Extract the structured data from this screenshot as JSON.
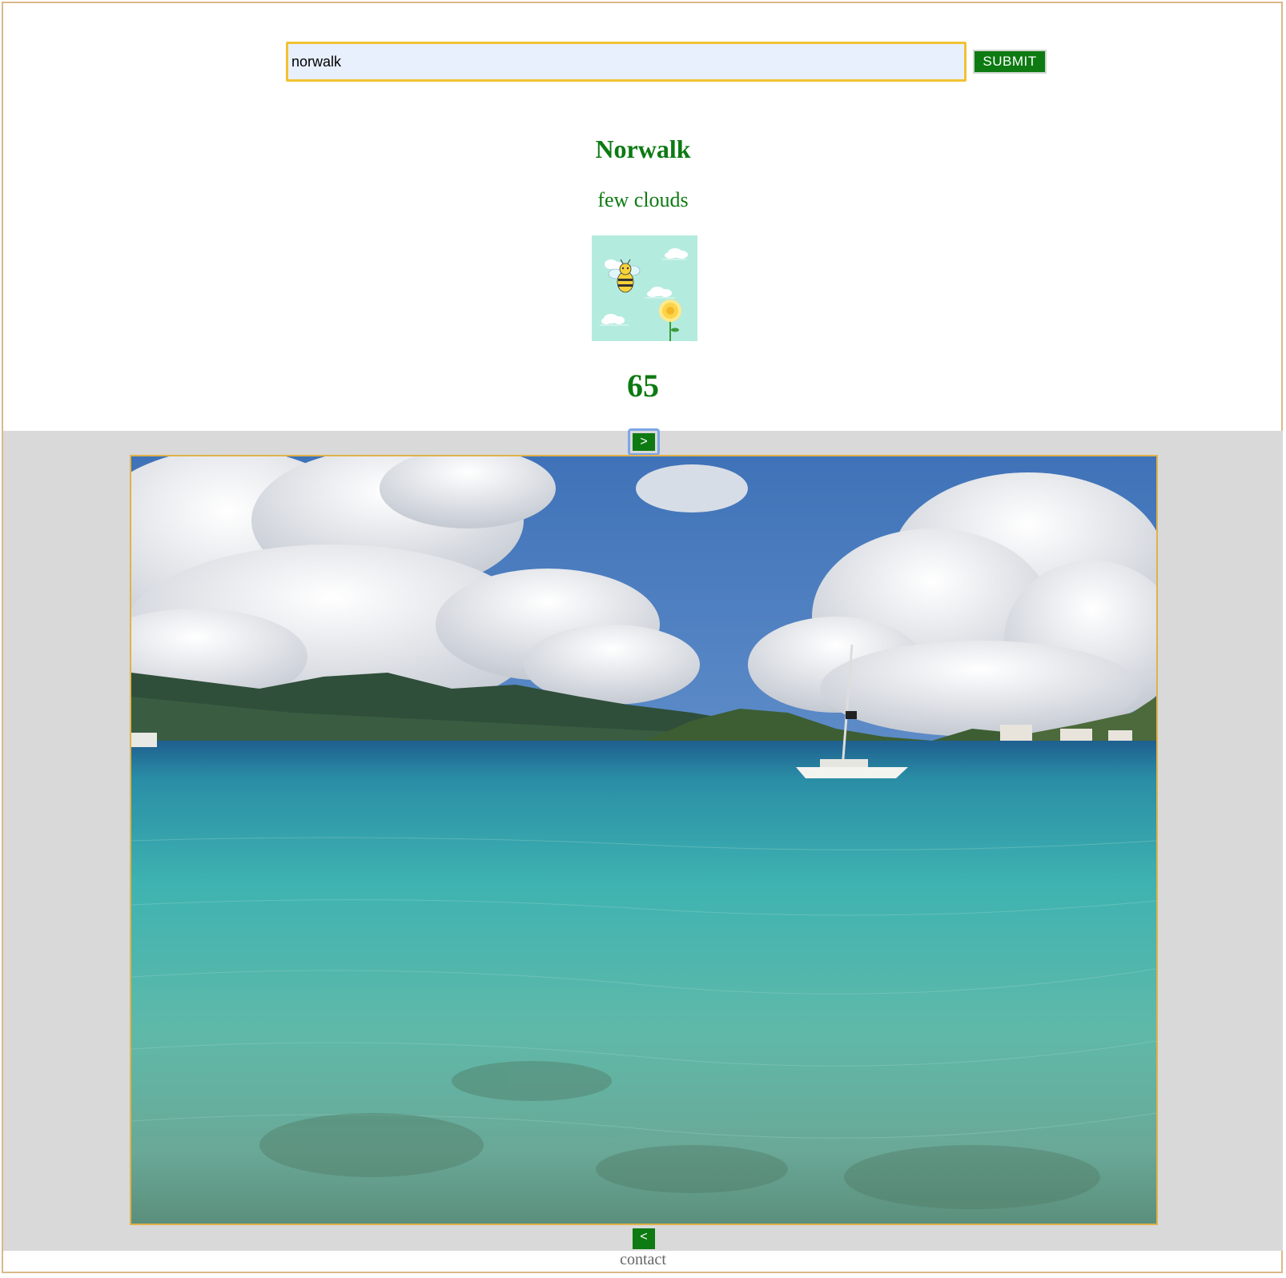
{
  "search": {
    "value": "norwalk",
    "submit_label": "SUBMIT"
  },
  "weather": {
    "city": "Norwalk",
    "description": "few clouds",
    "temperature": "65",
    "icon": "bee-flower-clouds-icon"
  },
  "gallery": {
    "next_label": ">",
    "prev_label": "<",
    "photo": "tropical-bay-sailboat-photo"
  },
  "footer": {
    "contact_label": "contact"
  },
  "colors": {
    "accent_green": "#0d7a12",
    "input_border": "#f1c232",
    "input_bg": "#e8f0fe",
    "gallery_bg": "#d9d9d9",
    "photo_border": "#e0b24a"
  }
}
